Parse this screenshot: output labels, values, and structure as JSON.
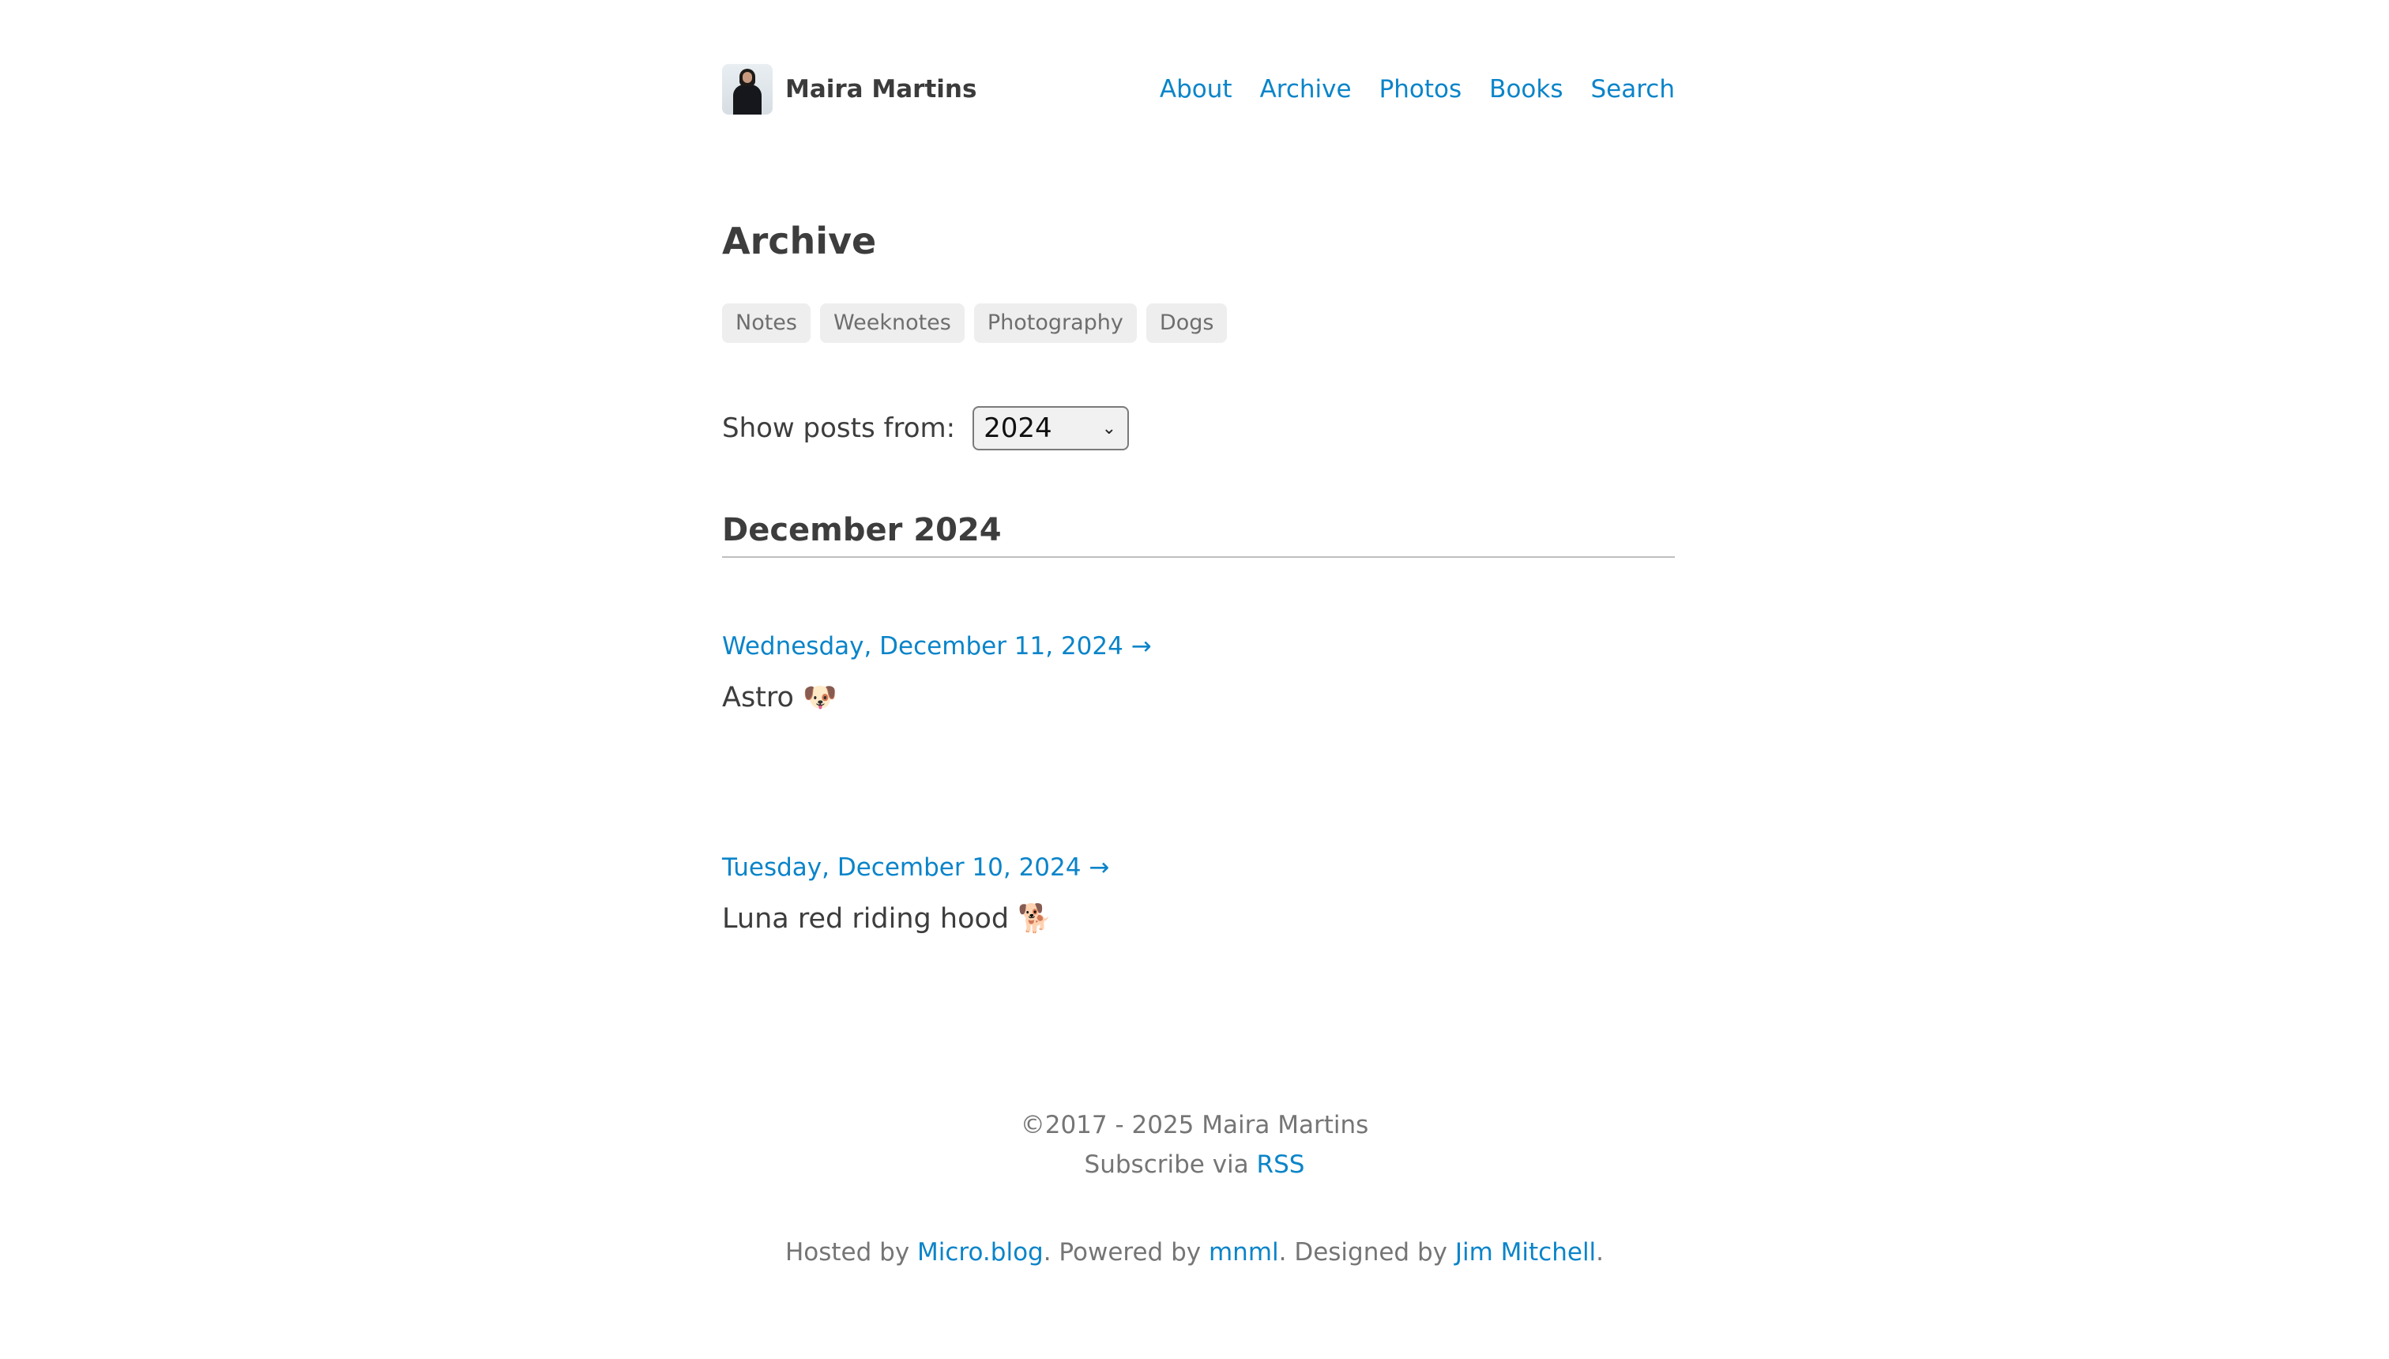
{
  "header": {
    "site_name": "Maira Martins",
    "nav": [
      "About",
      "Archive",
      "Photos",
      "Books",
      "Search"
    ]
  },
  "main": {
    "title": "Archive",
    "tags": [
      "Notes",
      "Weeknotes",
      "Photography",
      "Dogs"
    ],
    "filter": {
      "label": "Show posts from:",
      "selected_year": "2024"
    },
    "month": "December 2024",
    "posts": [
      {
        "date": "Wednesday, December 11, 2024 →",
        "text": "Astro 🐶"
      },
      {
        "date": "Tuesday, December 10, 2024 →",
        "text": "Luna red riding hood 🐕"
      }
    ]
  },
  "footer": {
    "copyright": "©2017 - 2025 Maira Martins",
    "subscribe_prefix": "Subscribe via",
    "rss": "RSS",
    "hosted_prefix": "Hosted by",
    "host": "Micro.blog",
    "powered_prefix": ". Powered by",
    "theme": "mnml",
    "designed_prefix": ". Designed by",
    "designer": "Jim Mitchell",
    "end": "."
  },
  "colors": {
    "link": "#0a84c9",
    "text": "#3d3d3d",
    "muted": "#757575",
    "tag_bg": "#eeeeee"
  }
}
